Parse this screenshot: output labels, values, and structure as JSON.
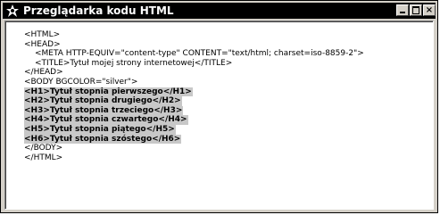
{
  "window": {
    "title": "Przeglądarka kodu HTML",
    "icon": "browser-app-icon",
    "buttons": {
      "minimize": "minimize-icon",
      "maximize": "maximize-icon",
      "close": "close-icon"
    }
  },
  "code": {
    "lines": [
      "<HTML>",
      "<HEAD>",
      "<META HTTP-EQUIV=\"content-type\" CONTENT=\"text/html; charset=iso-8859-2\">",
      "<TITLE>Tytuł mojej strony internetowej</TITLE>",
      "</HEAD>",
      "<BODY BGCOLOR=\"silver\">",
      "<H1>Tytuł stopnia pierwszego</H1>",
      "<H2>Tytuł stopnia drugiego</H2>",
      "<H3>Tytuł stopnia trzeciego</H3>",
      "<H4>Tytuł stopnia czwartego</H4>",
      "<H5>Tytuł stopnia piątego</H5>",
      "<H6>Tytuł stopnia szóstego</H6>",
      "</BODY>",
      "</HTML>"
    ]
  },
  "colors": {
    "titlebar": "#000000",
    "highlight": "#c8c8c8",
    "chrome": "#d4d0c8"
  }
}
